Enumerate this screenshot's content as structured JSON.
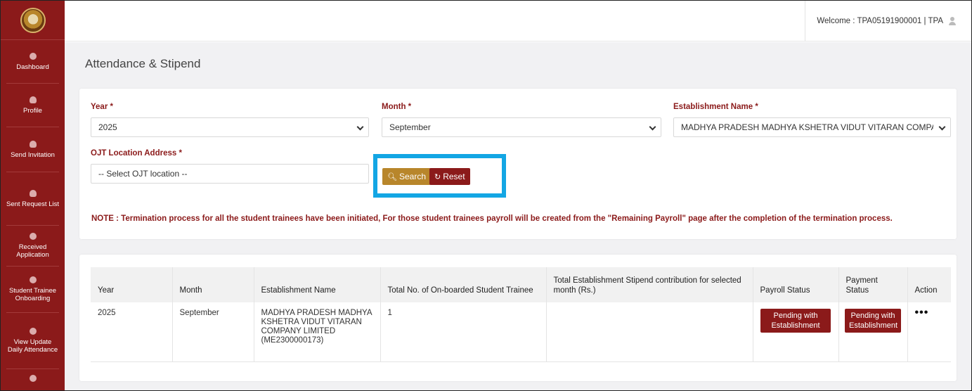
{
  "header": {
    "welcome_text": "Welcome : TPA05191900001 | TPA"
  },
  "sidebar": {
    "items": [
      {
        "label": "Dashboard",
        "icon": "circle-icon"
      },
      {
        "label": "Profile",
        "icon": "person-icon"
      },
      {
        "label": "Send Invitation",
        "icon": "person-icon"
      },
      {
        "label": "Sent Request List",
        "icon": "person-icon"
      },
      {
        "label": "Received Application",
        "icon": "circle-icon"
      },
      {
        "label": "Student Trainee Onboarding",
        "icon": "circle-icon"
      },
      {
        "label": "View Update Daily Attendance",
        "icon": "circle-icon"
      }
    ]
  },
  "page": {
    "title": "Attendance & Stipend"
  },
  "filters": {
    "year_label": "Year *",
    "year_value": "2025",
    "month_label": "Month *",
    "month_value": "September",
    "establishment_label": "Establishment Name *",
    "establishment_value": "MADHYA PRADESH MADHYA KSHETRA VIDUT VITARAN COMPANY LIMITED (ME2300000173)",
    "ojt_label": "OJT Location Address *",
    "ojt_placeholder": "-- Select OJT location --",
    "search_label": "Search",
    "reset_label": "Reset"
  },
  "note": "NOTE : Termination process for all the student trainees have been initiated, For those student trainees payroll will be created from the \"Remaining Payroll\" page after the completion of the termination process.",
  "table": {
    "headers": [
      "Year",
      "Month",
      "Establishment Name",
      "Total No. of On-boarded Student Trainee",
      "Total Establishment Stipend contribution for selected month (Rs.)",
      "Payroll Status",
      "Payment Status",
      "Action"
    ],
    "rows": [
      {
        "year": "2025",
        "month": "September",
        "establishment": "MADHYA PRADESH MADHYA KSHETRA VIDUT VITARAN COMPANY LIMITED (ME2300000173)",
        "onboarded": "1",
        "stipend": "",
        "payroll_status": "Pending with Establishment",
        "payment_status": "Pending with Establishment",
        "action": "•••"
      }
    ]
  },
  "colors": {
    "brand": "#8b1a1a",
    "search_button": "#b8862b",
    "highlight": "#13a6e4"
  }
}
